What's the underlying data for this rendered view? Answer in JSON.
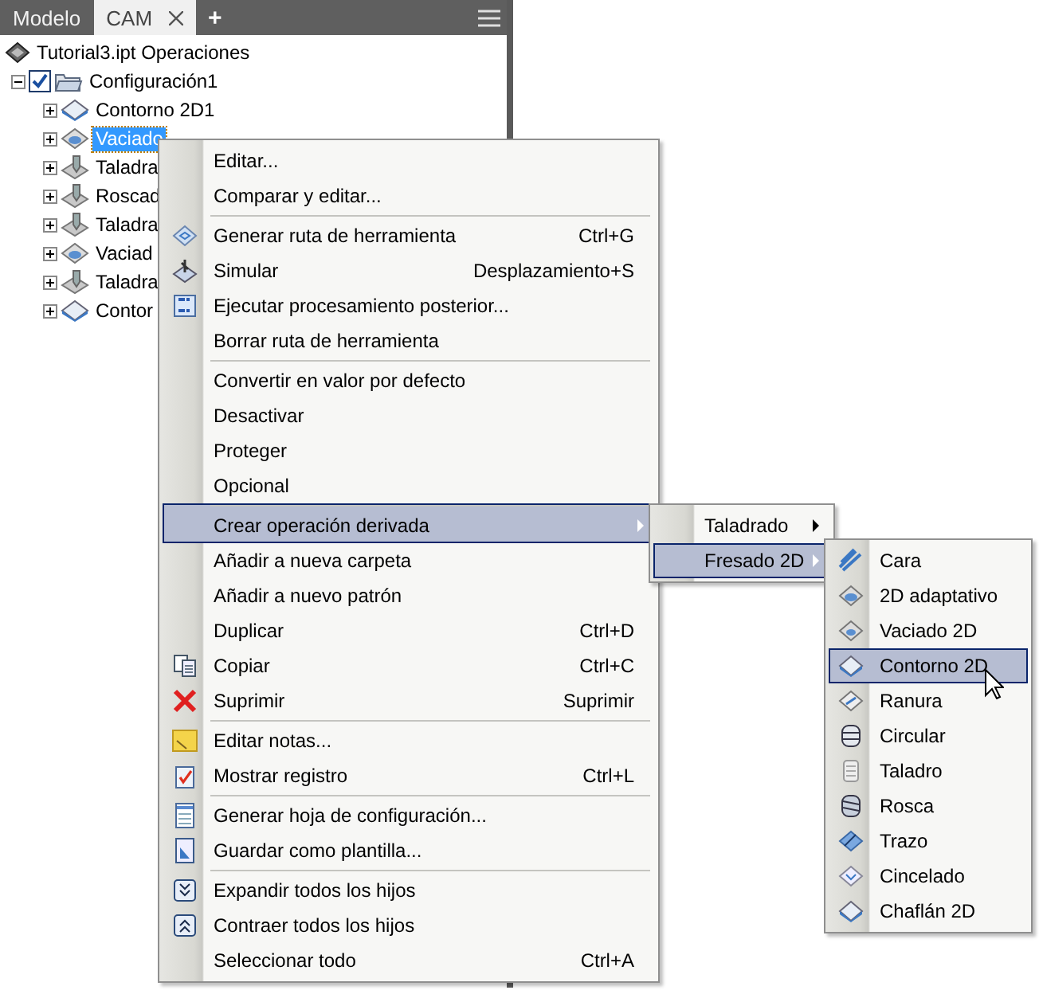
{
  "tabs": [
    {
      "label": "Modelo",
      "selected": false,
      "closable": false
    },
    {
      "label": "CAM",
      "selected": true,
      "closable": true
    }
  ],
  "add_tab": "+",
  "tree": [
    {
      "label": "Tutorial3.ipt Operaciones",
      "children": [
        {
          "label": "Configuración1",
          "checked": true,
          "expanded": true,
          "selected": false,
          "children": [
            {
              "label": "Contorno 2D1",
              "expanded": false,
              "selected": false
            },
            {
              "label": "Vaciado",
              "expanded": false,
              "selected": true
            },
            {
              "label": "Taladra",
              "expanded": false,
              "selected": false
            },
            {
              "label": "Roscad",
              "expanded": false,
              "selected": false
            },
            {
              "label": "Taladra",
              "expanded": false,
              "selected": false
            },
            {
              "label": "Vaciad",
              "expanded": false,
              "selected": false
            },
            {
              "label": "Taladra",
              "expanded": false,
              "selected": false
            },
            {
              "label": "Contor",
              "expanded": false,
              "selected": false
            }
          ]
        }
      ]
    }
  ],
  "context_menu": [
    {
      "label": "Editar...",
      "separator_before": false,
      "selected": false,
      "submenu": false
    },
    {
      "label": "Comparar y editar...",
      "separator_before": false,
      "selected": false,
      "submenu": false
    },
    {
      "label": "Generar ruta de herramienta",
      "shortcut": "Ctrl+G",
      "separator_before": true,
      "selected": false,
      "submenu": false
    },
    {
      "label": "Simular",
      "shortcut": "Desplazamiento+S",
      "separator_before": false,
      "selected": false,
      "submenu": false
    },
    {
      "label": "Ejecutar procesamiento posterior...",
      "separator_before": false,
      "selected": false,
      "submenu": false
    },
    {
      "label": "Borrar ruta de herramienta",
      "separator_before": false,
      "selected": false,
      "submenu": false
    },
    {
      "label": "Convertir en valor por defecto",
      "separator_before": true,
      "selected": false,
      "submenu": false
    },
    {
      "label": "Desactivar",
      "separator_before": false,
      "selected": false,
      "submenu": false
    },
    {
      "label": "Proteger",
      "separator_before": false,
      "selected": false,
      "submenu": false
    },
    {
      "label": "Opcional",
      "separator_before": false,
      "selected": false,
      "submenu": false
    },
    {
      "label": "Crear operación derivada",
      "separator_before": true,
      "selected": true,
      "submenu": true
    },
    {
      "label": "Añadir a nueva carpeta",
      "separator_before": false,
      "selected": false,
      "submenu": false
    },
    {
      "label": "Añadir a nuevo patrón",
      "separator_before": false,
      "selected": false,
      "submenu": false
    },
    {
      "label": "Duplicar",
      "shortcut": "Ctrl+D",
      "separator_before": false,
      "selected": false,
      "submenu": false
    },
    {
      "label": "Copiar",
      "shortcut": "Ctrl+C",
      "separator_before": false,
      "selected": false,
      "submenu": false
    },
    {
      "label": "Suprimir",
      "shortcut": "Suprimir",
      "separator_before": false,
      "selected": false,
      "submenu": false
    },
    {
      "label": "Editar notas...",
      "separator_before": true,
      "selected": false,
      "submenu": false
    },
    {
      "label": "Mostrar registro",
      "shortcut": "Ctrl+L",
      "separator_before": false,
      "selected": false,
      "submenu": false
    },
    {
      "label": "Generar hoja de configuración...",
      "separator_before": true,
      "selected": false,
      "submenu": false
    },
    {
      "label": "Guardar como plantilla...",
      "separator_before": false,
      "selected": false,
      "submenu": false
    },
    {
      "label": "Expandir todos los hijos",
      "separator_before": true,
      "selected": false,
      "submenu": false
    },
    {
      "label": "Contraer todos los hijos",
      "separator_before": false,
      "selected": false,
      "submenu": false
    },
    {
      "label": "Seleccionar todo",
      "shortcut": "Ctrl+A",
      "separator_before": false,
      "selected": false,
      "submenu": false
    }
  ],
  "derived_menu": [
    {
      "label": "Taladrado",
      "selected": false,
      "submenu": true
    },
    {
      "label": "Fresado 2D",
      "selected": true,
      "submenu": true
    }
  ],
  "milling_menu": [
    {
      "label": "Cara",
      "selected": false
    },
    {
      "label": "2D adaptativo",
      "selected": false
    },
    {
      "label": "Vaciado 2D",
      "selected": false
    },
    {
      "label": "Contorno 2D",
      "selected": true
    },
    {
      "label": "Ranura",
      "selected": false
    },
    {
      "label": "Circular",
      "selected": false
    },
    {
      "label": "Taladro",
      "selected": false
    },
    {
      "label": "Rosca",
      "selected": false
    },
    {
      "label": "Trazo",
      "selected": false
    },
    {
      "label": "Cincelado",
      "selected": false
    },
    {
      "label": "Chaflán 2D",
      "selected": false
    }
  ]
}
